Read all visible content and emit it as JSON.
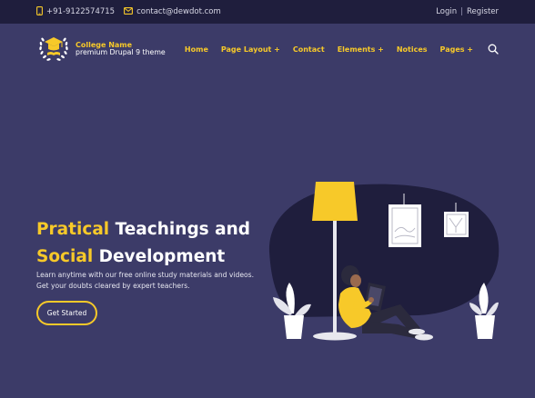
{
  "topbar": {
    "phone": "+91-9122574715",
    "email": "contact@dewdot.com",
    "login": "Login",
    "separator": "|",
    "register": "Register"
  },
  "brand": {
    "name": "College Name",
    "tagline": "premium Drupal 9 theme"
  },
  "nav": {
    "items": [
      "Home",
      "Page Layout +",
      "Contact",
      "Elements +",
      "Notices",
      "Pages +"
    ]
  },
  "hero": {
    "title_line1_highlight": "Pratical",
    "title_line1_rest": " Teachings and",
    "title_line2_highlight": "Social",
    "title_line2_rest": " Development",
    "description": "Learn anytime with our free online study materials and videos. Get your doubts cleared by expert teachers.",
    "cta_label": "Get Started"
  },
  "colors": {
    "background": "#3c3b68",
    "topbar": "#1f1e3d",
    "accent": "#f7c929",
    "blob": "#1f1e3d"
  },
  "icons": {
    "phone": "phone-icon",
    "email": "email-icon",
    "logo": "graduation-cap-wreath-logo",
    "search": "search-icon"
  }
}
